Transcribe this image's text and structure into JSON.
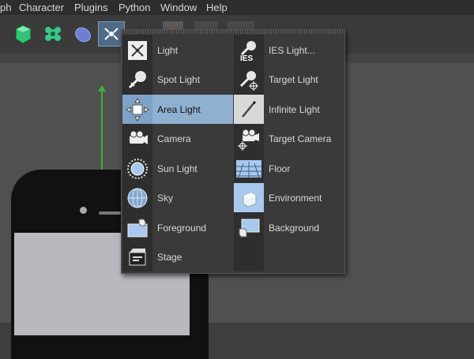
{
  "menubar": {
    "items": [
      "ph",
      "Character",
      "Plugins",
      "Python",
      "Window",
      "Help"
    ]
  },
  "popup": {
    "left": [
      {
        "label": "Light",
        "icon": "light-icon"
      },
      {
        "label": "Spot Light",
        "icon": "spot-light-icon"
      },
      {
        "label": "Area Light",
        "icon": "area-light-icon",
        "highlighted": true
      },
      {
        "label": "Camera",
        "icon": "camera-icon"
      },
      {
        "label": "Sun Light",
        "icon": "sun-light-icon"
      },
      {
        "label": "Sky",
        "icon": "sky-icon"
      },
      {
        "label": "Foreground",
        "icon": "foreground-icon"
      },
      {
        "label": "Stage",
        "icon": "stage-icon"
      }
    ],
    "right": [
      {
        "label": "IES Light...",
        "icon": "ies-light-icon",
        "badge": "IES"
      },
      {
        "label": "Target Light",
        "icon": "target-light-icon"
      },
      {
        "label": "Infinite Light",
        "icon": "infinite-light-icon"
      },
      {
        "label": "Target Camera",
        "icon": "target-camera-icon"
      },
      {
        "label": "Floor",
        "icon": "floor-icon"
      },
      {
        "label": "Environment",
        "icon": "environment-icon"
      },
      {
        "label": "Background",
        "icon": "background-icon"
      }
    ]
  },
  "colors": {
    "highlight": "#8fb0d0",
    "menu_bg": "#3a3a3a",
    "axis_green": "#3bb23b"
  }
}
